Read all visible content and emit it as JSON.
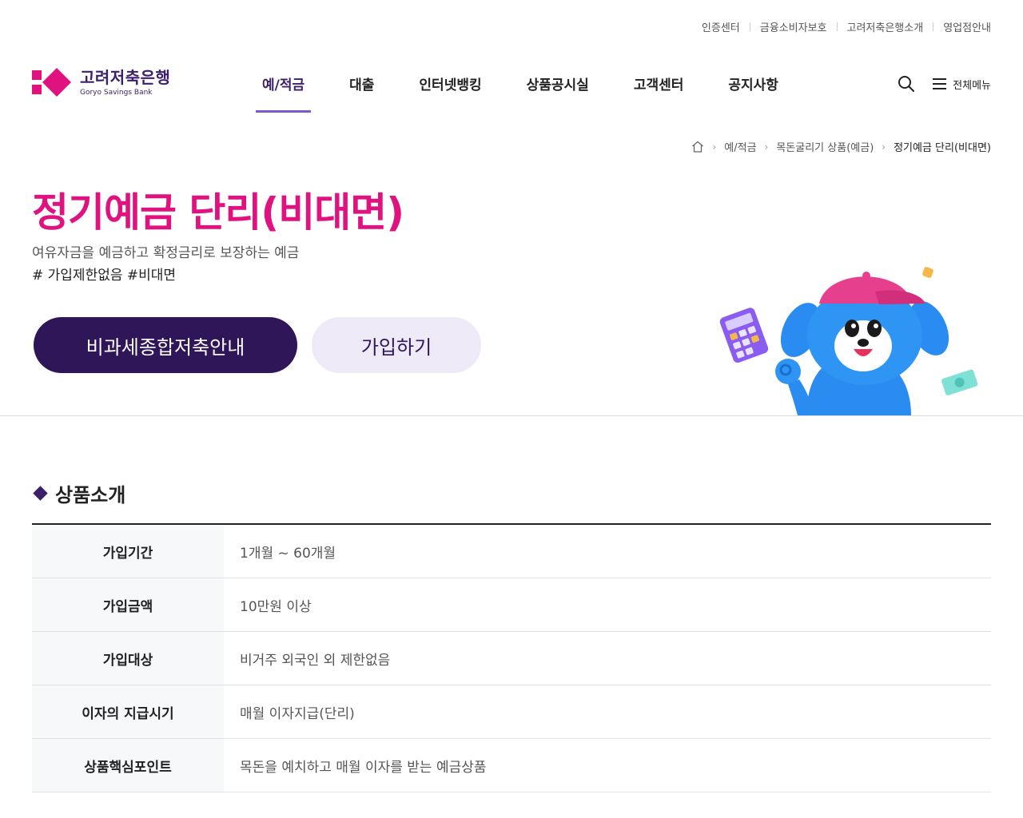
{
  "util_links": [
    "인증센터",
    "금융소비자보호",
    "고려저축은행소개",
    "영업점안내"
  ],
  "logo": {
    "name": "고려저축은행",
    "english": "Goryo Savings Bank"
  },
  "gnb": [
    "예/적금",
    "대출",
    "인터넷뱅킹",
    "상품공시실",
    "고객센터",
    "공지사항"
  ],
  "header": {
    "menu_label": "전체메뉴",
    "search_icon": "search-icon",
    "menu_icon": "hamburger-icon"
  },
  "breadcrumb": {
    "home_icon": "home-icon",
    "items": [
      "예/적금",
      "목돈굴리기 상품(예금)",
      "정기예금 단리(비대면)"
    ]
  },
  "hero": {
    "title": "정기예금 단리(비대면)",
    "description": "여유자금을 예금하고 확정금리로 보장하는 예금",
    "tags": "# 가입제한없음 #비대면",
    "primary_button": "비과세종합저축안내",
    "secondary_button": "가입하기"
  },
  "section": {
    "title": "상품소개",
    "rows": [
      {
        "label": "가입기간",
        "value": "1개월 ~ 60개월"
      },
      {
        "label": "가입금액",
        "value": "10만원 이상"
      },
      {
        "label": "가입대상",
        "value": "비거주 외국인 외 제한없음"
      },
      {
        "label": "이자의 지급시기",
        "value": "매월 이자지급(단리)"
      },
      {
        "label": "상품핵심포인트",
        "value": "목돈을 예치하고 매월 이자를 받는 예금상품"
      }
    ]
  },
  "colors": {
    "accent": "#e0127f",
    "brand": "#3b1f6b",
    "button_dark": "#2e1659",
    "button_light": "#efeaf8",
    "gnb_underline": "#7c5cc4"
  }
}
